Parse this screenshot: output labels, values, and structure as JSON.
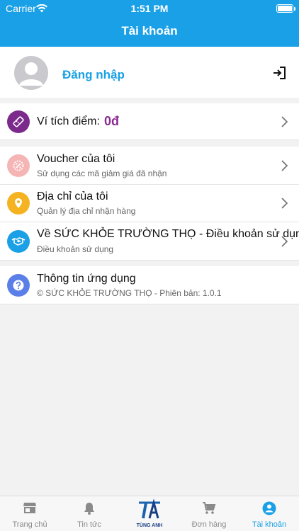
{
  "status_bar": {
    "carrier": "Carrier",
    "time": "1:51 PM"
  },
  "header": {
    "title": "Tài khoản"
  },
  "login": {
    "label": "Đăng nhập"
  },
  "wallet": {
    "label": "Ví tích điểm:",
    "value": "0đ"
  },
  "menu": [
    {
      "title": "Voucher của tôi",
      "subtitle": "Sử dụng các mã giảm giá đã nhận",
      "icon": "voucher-icon"
    },
    {
      "title": "Địa chỉ của tôi",
      "subtitle": "Quản lý địa chỉ nhận hàng",
      "icon": "location-pin-icon"
    },
    {
      "title": "Về SỨC KHỎE TRƯỜNG THỌ - Điều khoản sử dụng",
      "subtitle": "Điều khoản sử dụng",
      "icon": "handshake-icon"
    }
  ],
  "app_info": {
    "title": "Thông tin ứng dụng",
    "subtitle": "© SỨC KHỎE TRƯỜNG THỌ - Phiên bản: 1.0.1"
  },
  "tabs": [
    {
      "label": "Trang chủ",
      "icon": "store-icon"
    },
    {
      "label": "Tin tức",
      "icon": "bell-icon"
    },
    {
      "label": "TÙNG ANH",
      "icon": "brand-logo"
    },
    {
      "label": "Đơn hàng",
      "icon": "cart-icon"
    },
    {
      "label": "Tài khoản",
      "icon": "account-icon",
      "active": true
    }
  ],
  "colors": {
    "primary": "#1aa0e6",
    "wallet_icon": "#7b2a8c",
    "voucher_icon": "#f6b5b5",
    "location_icon": "#f5b321",
    "terms_icon": "#1aa0e6",
    "info_icon": "#5b7fe8"
  }
}
